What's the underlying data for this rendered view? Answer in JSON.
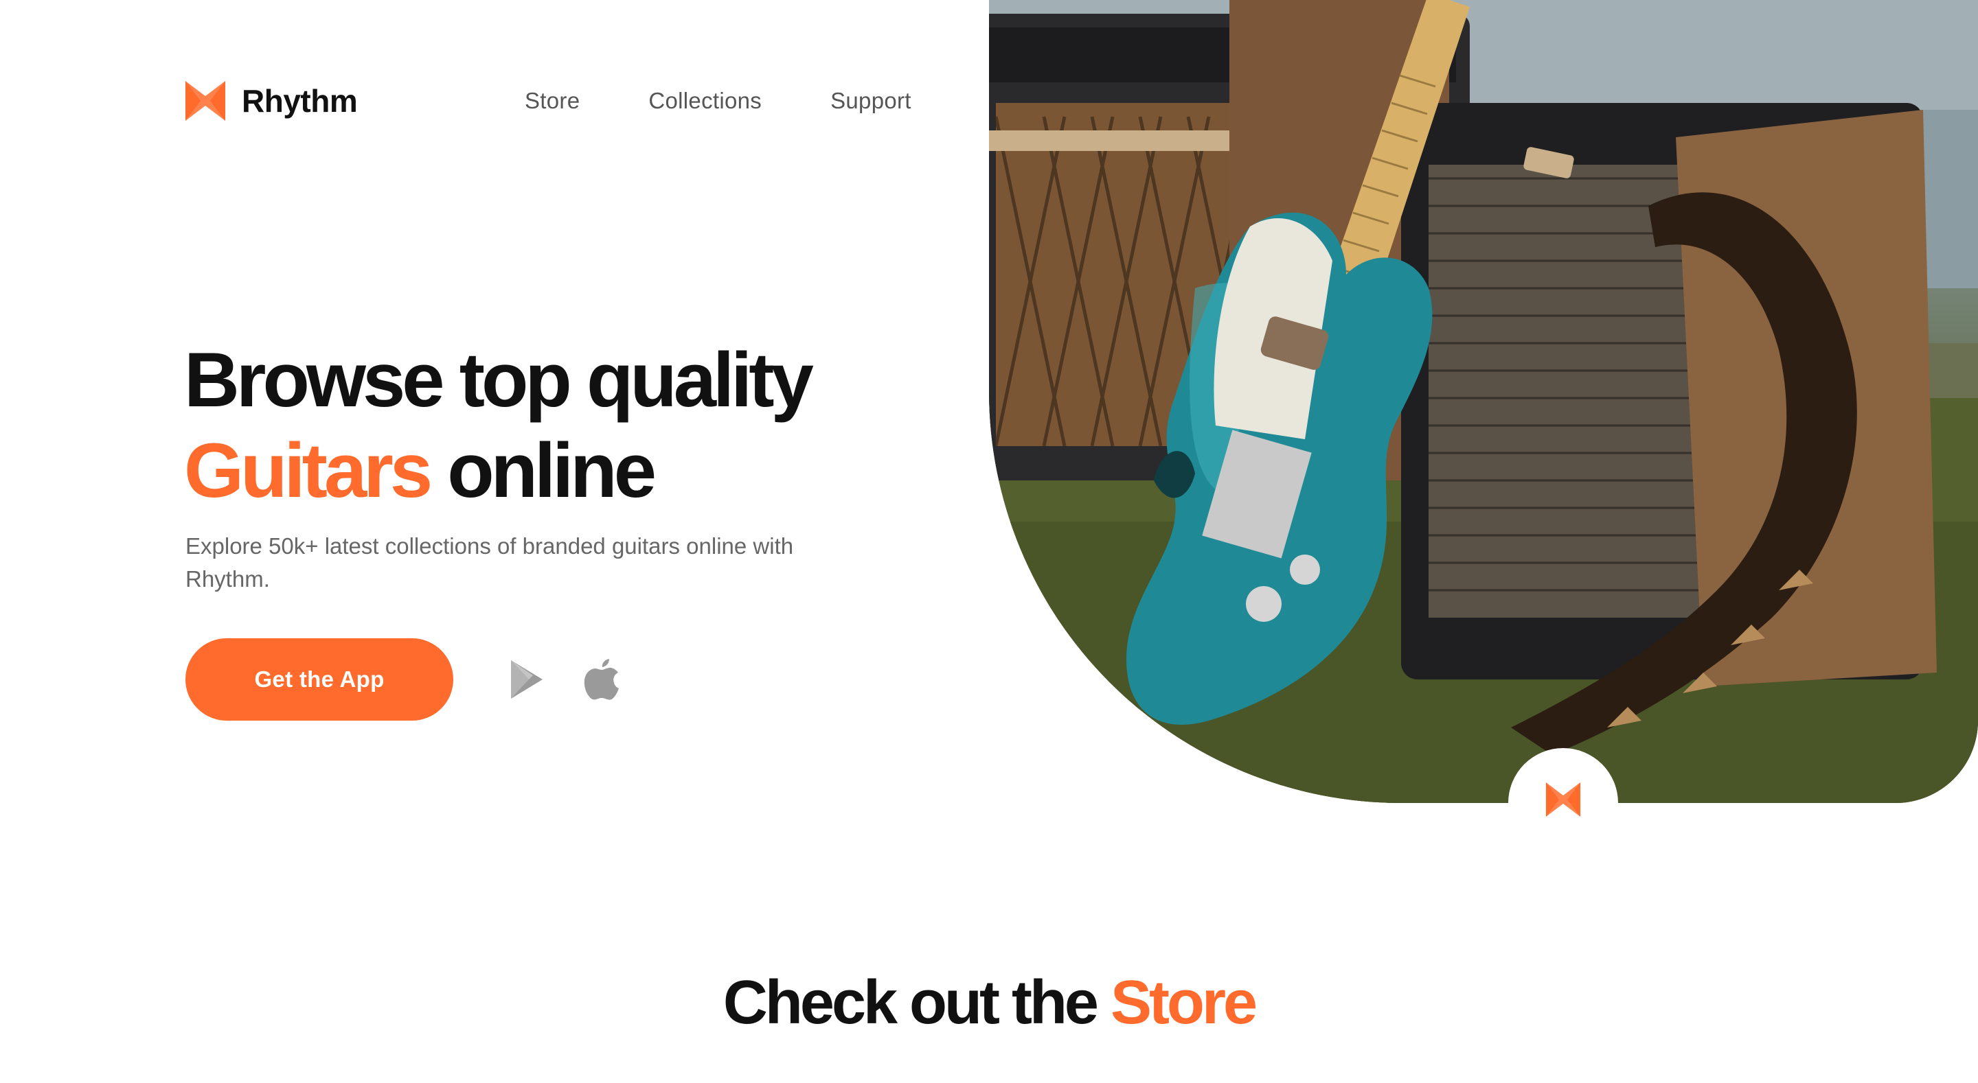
{
  "brand": {
    "name": "Rhythm",
    "accent_color": "#ff6b2c",
    "logo_icon": "rhythm-logo-icon"
  },
  "nav": {
    "items": [
      {
        "label": "Store"
      },
      {
        "label": "Collections"
      },
      {
        "label": "Support"
      }
    ]
  },
  "hero": {
    "title_line1": "Browse top quality",
    "title_accent": "Guitars",
    "title_rest": " online",
    "description": "Explore 50k+ latest collections of branded guitars online with Rhythm.",
    "cta_label": "Get the App",
    "store_icons": [
      "google-play-icon",
      "apple-icon"
    ],
    "image_subject": "teal electric guitar leaning on amplifiers on grass"
  },
  "section": {
    "title_prefix": "Check out the ",
    "title_accent": "Store"
  }
}
